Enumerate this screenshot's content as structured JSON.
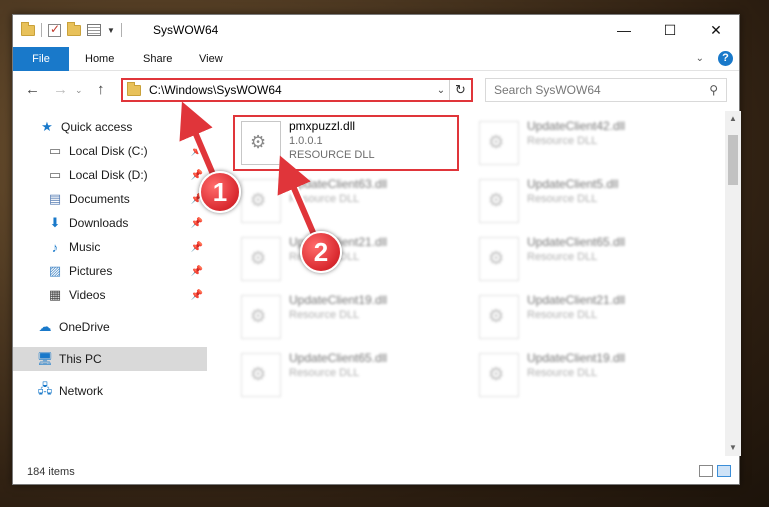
{
  "window": {
    "title": "SysWOW64",
    "controls": {
      "minimize": "—",
      "maximize": "☐",
      "close": "✕"
    }
  },
  "ribbon": {
    "tabs": [
      "File",
      "Home",
      "Share",
      "View"
    ],
    "help": "?"
  },
  "nav": {
    "address": "C:\\Windows\\SysWOW64",
    "search_placeholder": "Search SysWOW64"
  },
  "sidebar": {
    "items": [
      {
        "label": "Quick access",
        "icon": "star-icon",
        "pinned": false
      },
      {
        "label": "Local Disk (C:)",
        "icon": "drive-icon",
        "pinned": true
      },
      {
        "label": "Local Disk (D:)",
        "icon": "drive-icon",
        "pinned": true
      },
      {
        "label": "Documents",
        "icon": "documents-icon",
        "pinned": true
      },
      {
        "label": "Downloads",
        "icon": "download-icon",
        "pinned": true
      },
      {
        "label": "Music",
        "icon": "music-icon",
        "pinned": true
      },
      {
        "label": "Pictures",
        "icon": "pictures-icon",
        "pinned": true
      },
      {
        "label": "Videos",
        "icon": "videos-icon",
        "pinned": true
      },
      {
        "label": "OneDrive",
        "icon": "cloud-icon",
        "pinned": false
      },
      {
        "label": "This PC",
        "icon": "computer-icon",
        "pinned": false,
        "selected": true
      },
      {
        "label": "Network",
        "icon": "network-icon",
        "pinned": false
      }
    ]
  },
  "files": [
    {
      "name": "pmxpuzzl.dll",
      "version": "1.0.0.1",
      "type": "RESOURCE DLL",
      "highlighted": true
    },
    {
      "name": "UpdateClient42.dll",
      "type": "Resource DLL"
    },
    {
      "name": "UpdateClient63.dll",
      "type": "Resource DLL"
    },
    {
      "name": "UpdateClient5.dll",
      "type": "Resource DLL"
    },
    {
      "name": "UpdateClient21.dll",
      "type": "Resource DLL"
    },
    {
      "name": "UpdateClient65.dll",
      "type": "Resource DLL"
    },
    {
      "name": "UpdateClient19.dll",
      "type": "Resource DLL"
    },
    {
      "name": "UpdateClient21.dll",
      "type": "Resource DLL"
    },
    {
      "name": "UpdateClient65.dll",
      "type": "Resource DLL"
    },
    {
      "name": "UpdateClient19.dll",
      "type": "Resource DLL"
    }
  ],
  "status": {
    "item_count": "184 items"
  },
  "annotations": {
    "step1": "1",
    "step2": "2"
  },
  "colors": {
    "accent": "#1979ca",
    "highlight": "#e0353a",
    "selected": "#d9d9d9"
  }
}
